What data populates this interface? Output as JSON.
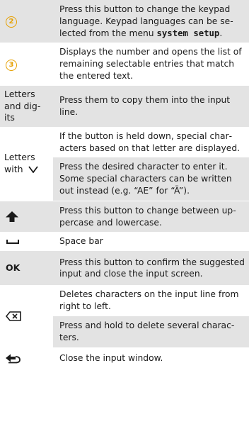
{
  "rows": [
    {
      "key_text": "2",
      "desc": [
        {
          "before": "Press this button to change the keypad language. Keypad languages can be se­lected from the menu ",
          "mono": "system setup",
          "after": "."
        }
      ]
    },
    {
      "key_text": "3",
      "desc": [
        {
          "before": "Displays the number and opens the list of remaining selectable entries that match the entered text."
        }
      ]
    },
    {
      "key_text": "Letters and dig­its",
      "desc": [
        {
          "before": "Press them to copy them into the input line."
        }
      ]
    },
    {
      "key_text": "Letters with",
      "desc": [
        {
          "before": "If the button is held down, special char­acters based on that letter are displayed."
        },
        {
          "before": "Press the desired character to enter it. Some special characters can be written out instead (e.g. “AE” for “Ä”)."
        }
      ]
    },
    {
      "key_icon": "shift-arrow-up-icon",
      "desc": [
        {
          "before": "Press this button to change between up­percase and lowercase."
        }
      ]
    },
    {
      "key_icon": "space-bar-icon",
      "desc": [
        {
          "before": "Space bar"
        }
      ]
    },
    {
      "key_text": "OK",
      "desc": [
        {
          "before": "Press this button to confirm the sugges­ted input and close the input screen."
        }
      ]
    },
    {
      "key_icon": "backspace-icon",
      "desc": [
        {
          "before": "Deletes characters on the input line from right to left."
        },
        {
          "before": "Press and hold to delete several charac­ters."
        }
      ]
    },
    {
      "key_icon": "return-arrow-icon",
      "desc": [
        {
          "before": "Close the input window."
        }
      ]
    }
  ],
  "colors": {
    "row_gray": "#e3e3e3",
    "row_white": "#ffffff",
    "circle_accent": "#e6a000"
  }
}
